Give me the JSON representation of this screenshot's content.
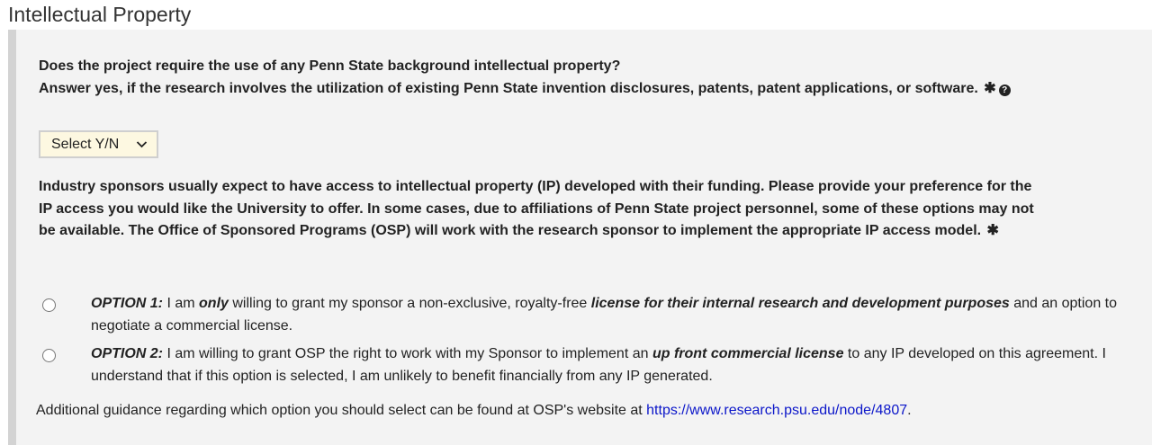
{
  "section": {
    "title": "Intellectual Property"
  },
  "question1": {
    "line1": "Does the project require the use of any Penn State background intellectual property?",
    "line2": "Answer yes, if the research involves the utilization of existing Penn State invention disclosures, patents, patent applications, or software.",
    "required_mark": "✱",
    "help_icon": "?",
    "select_value": "Select Y/N",
    "select_chevron": "⌄"
  },
  "question2": {
    "text": "Industry sponsors usually expect to have access to intellectual property (IP) developed with their funding. Please provide your preference for the IP access you would like the University to offer. In some cases, due to affiliations of Penn State project personnel, some of these options may not be available. The Office of Sponsored Programs (OSP) will work with the research sponsor to implement the appropriate IP access model.",
    "required_mark": "✱"
  },
  "options": [
    {
      "label": "OPTION 1:",
      "t1": " I am ",
      "em1": "only",
      "t2": " willing to grant my sponsor a non-exclusive, royalty-free ",
      "em2": "license for their internal research and development purposes",
      "t3": " and an option to negotiate a commercial license."
    },
    {
      "label": "OPTION 2:",
      "t1": " I am willing to grant OSP the right to work with my Sponsor to implement an ",
      "em1": "up front commercial license",
      "t2": " to any IP developed on this agreement. I understand that if this option is selected, I am unlikely to benefit financially from any IP generated."
    }
  ],
  "guidance": {
    "text": "Additional guidance regarding which option you should select can be found at OSP's website at ",
    "link_text": "https://www.research.psu.edu/node/4807",
    "end": "."
  }
}
